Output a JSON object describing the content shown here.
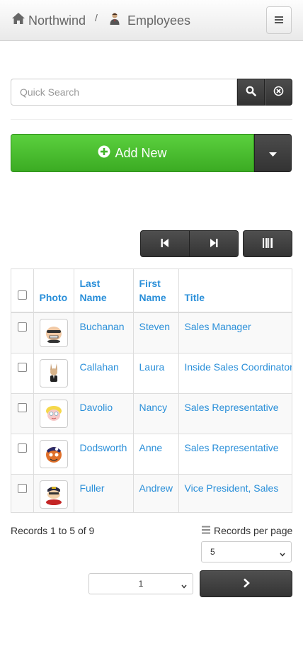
{
  "breadcrumb": {
    "home_label": "Northwind",
    "separator": "/",
    "page_label": "Employees"
  },
  "search": {
    "placeholder": "Quick Search",
    "value": ""
  },
  "actions": {
    "add_label": "Add New"
  },
  "grid": {
    "columns": {
      "photo": "Photo",
      "last_name": "Last Name",
      "first_name": "First Name",
      "title": "Title"
    },
    "rows": [
      {
        "last_name": "Buchanan",
        "first_name": "Steven",
        "title": "Sales Manager",
        "photo_icon": "buchanan-avatar-icon"
      },
      {
        "last_name": "Callahan",
        "first_name": "Laura",
        "title": "Inside Sales Coordinator",
        "photo_icon": "callahan-avatar-icon"
      },
      {
        "last_name": "Davolio",
        "first_name": "Nancy",
        "title": "Sales Representative",
        "photo_icon": "davolio-avatar-icon"
      },
      {
        "last_name": "Dodsworth",
        "first_name": "Anne",
        "title": "Sales Representative",
        "photo_icon": "dodsworth-avatar-icon"
      },
      {
        "last_name": "Fuller",
        "first_name": "Andrew",
        "title": "Vice President, Sales",
        "photo_icon": "fuller-avatar-icon"
      }
    ]
  },
  "footer": {
    "records_text": "Records 1 to 5 of 9",
    "per_page_label": "Records per page",
    "per_page_value": "5",
    "page_value": "1"
  },
  "colors": {
    "link": "#2a8fd9",
    "add_green": "#45bb2c",
    "dark_button": "#3a3a3a"
  }
}
